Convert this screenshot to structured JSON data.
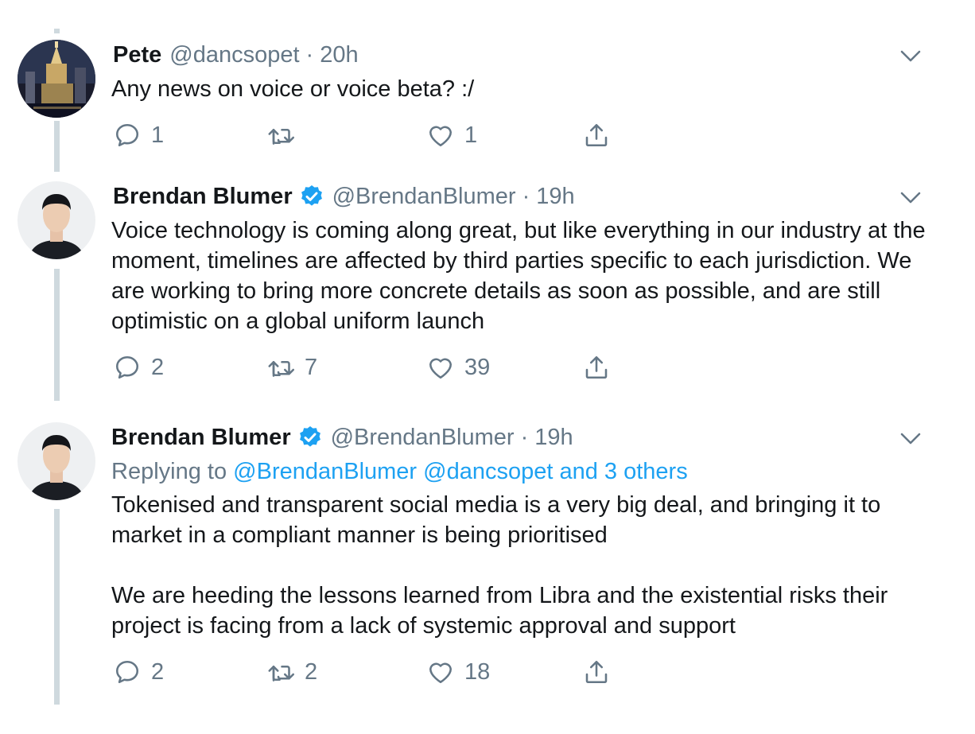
{
  "colors": {
    "accent": "#1da1f2",
    "muted": "#657786",
    "text": "#14171a",
    "thread_line": "#cfd9de"
  },
  "tweets": [
    {
      "name": "Pete",
      "verified": false,
      "handle": "@dancsopet",
      "separator": "·",
      "time": "20h",
      "reply_to": null,
      "body": [
        "Any news on voice or voice beta? :/"
      ],
      "replies": "1",
      "retweets": "",
      "likes": "1"
    },
    {
      "name": "Brendan Blumer",
      "verified": true,
      "handle": "@BrendanBlumer",
      "separator": "·",
      "time": "19h",
      "reply_to": null,
      "body": [
        "Voice technology is coming along great, but like everything in our industry at the moment, timelines are affected by third parties specific to each jurisdiction. We are working to bring more concrete details as soon as possible, and are still optimistic on a global uniform launch"
      ],
      "replies": "2",
      "retweets": "7",
      "likes": "39"
    },
    {
      "name": "Brendan Blumer",
      "verified": true,
      "handle": "@BrendanBlumer",
      "separator": "·",
      "time": "19h",
      "reply_to": {
        "prefix": "Replying to",
        "mentions": "@BrendanBlumer @dancsopet and 3 others"
      },
      "body": [
        "Tokenised and transparent social media is a very big deal, and bringing it to market in a compliant manner is being prioritised",
        "We are heeding the lessons learned from Libra and the existential risks their project is facing from a lack of systemic approval and support"
      ],
      "replies": "2",
      "retweets": "2",
      "likes": "18"
    }
  ]
}
